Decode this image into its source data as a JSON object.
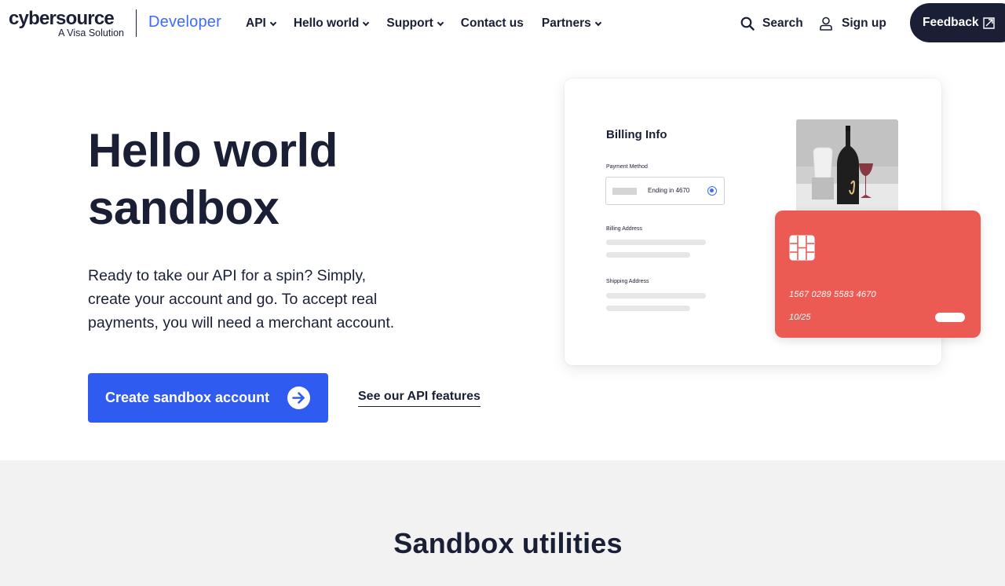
{
  "header": {
    "logo_main": "cybersource",
    "logo_sub": "A Visa Solution",
    "logo_product": "Developer",
    "nav": [
      {
        "label": "API",
        "has_dropdown": true
      },
      {
        "label": "Hello world",
        "has_dropdown": true
      },
      {
        "label": "Support",
        "has_dropdown": true
      },
      {
        "label": "Contact us",
        "has_dropdown": false
      },
      {
        "label": "Partners",
        "has_dropdown": true
      }
    ],
    "search_label": "Search",
    "signup_label": "Sign up",
    "feedback_label": "Feedback"
  },
  "hero": {
    "title_line1": "Hello world",
    "title_line2": "sandbox",
    "description": "Ready to take our API for a spin? Simply, create your account and go. To accept real payments, you will need a merchant account.",
    "cta_label": "Create sandbox account",
    "link_label": "See our API features"
  },
  "illustration": {
    "billing_title": "Billing Info",
    "payment_method_label": "Payment Method",
    "payment_method_value": "Ending in 4670",
    "billing_address_label": "Billing Address",
    "shipping_address_label": "Shipping Address",
    "card_number": "1567 0289 5583 4670",
    "card_expiry": "10/25"
  },
  "utilities": {
    "title": "Sandbox utilities"
  },
  "colors": {
    "navy": "#1a1f36",
    "brand_blue": "#2f5bf0",
    "developer_blue": "#3d6bff",
    "card_red": "#ec5b53",
    "section_gray": "#f2f2f2"
  }
}
